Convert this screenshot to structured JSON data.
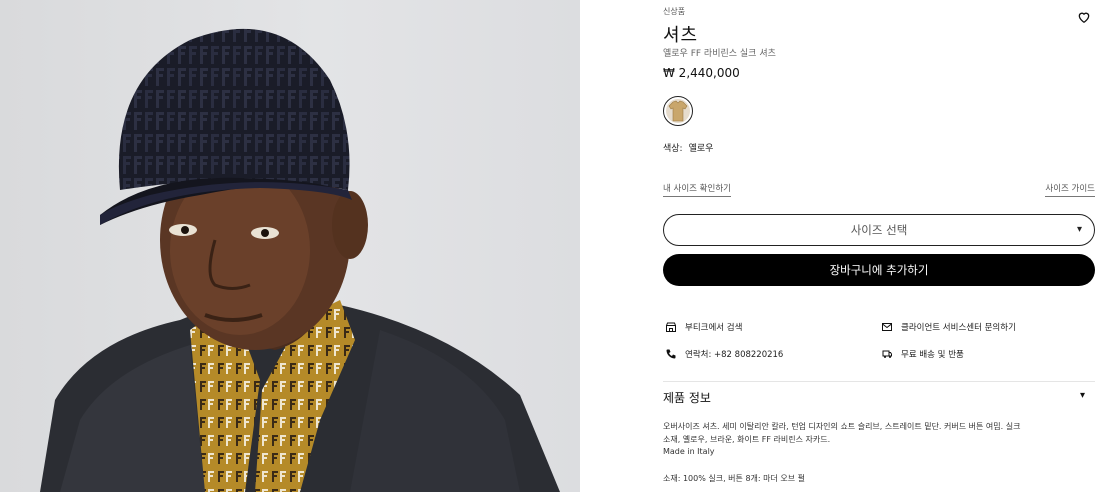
{
  "product": {
    "badge": "신상품",
    "title": "셔츠",
    "subtitle": "옐로우 FF 라비린스 실크 셔츠",
    "price": "₩ 2,440,000",
    "color_label": "색상:",
    "color_value": "옐로우",
    "swatch_color": "#c9a66b"
  },
  "sizing": {
    "check_label": "내 사이즈 확인하기",
    "guide_label": "사이즈 가이드",
    "select_label": "사이즈 선택",
    "select_caret": "▾"
  },
  "actions": {
    "add_to_cart": "장바구니에 추가하기"
  },
  "services": {
    "boutique": "부티크에서 검색",
    "client_service": "클라이언트 서비스센터 문의하기",
    "contact": "연락처: +82 808220216",
    "shipping": "무료 배송 및 반품"
  },
  "info": {
    "heading": "제품 정보",
    "caret": "▾",
    "description_line1": "오버사이즈 셔츠. 세미 이탈리안 칼라, 턴업 디자인의 쇼트 슬리브, 스트레이트 밑단. 커버드 버튼 여밈. 실크",
    "description_line2": "소재, 옐로우, 브라운, 화이트 FF 라비린스 자카드.",
    "made_in": "Made in Italy",
    "material": "소재: 100% 실크, 버튼 8개: 마더 오브 펄"
  },
  "icons": {
    "wishlist": "heart-icon",
    "boutique": "store-icon",
    "client_service": "mail-icon",
    "contact": "phone-icon",
    "shipping": "delivery-icon"
  },
  "colors": {
    "accent": "#000000",
    "text": "#111111",
    "muted": "#666666"
  }
}
